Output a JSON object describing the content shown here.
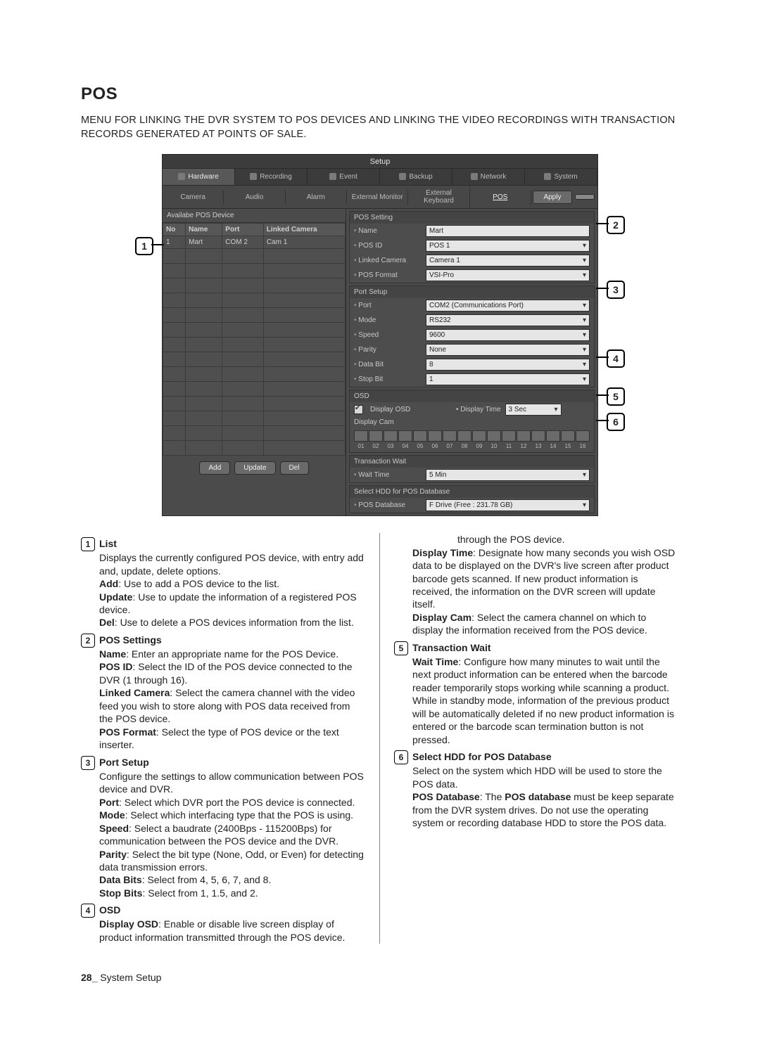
{
  "heading": "POS",
  "intro": "MENU FOR LINKING THE DVR SYSTEM TO POS DEVICES AND LINKING THE VIDEO RECORDINGS WITH TRANSACTION RECORDS GENERATED AT POINTS OF SALE.",
  "footer_page": "28_",
  "footer_text": "System Setup",
  "callouts": [
    "1",
    "2",
    "3",
    "4",
    "5",
    "6"
  ],
  "setup": {
    "window_title": "Setup",
    "tabs": [
      "Hardware",
      "Recording",
      "Event",
      "Backup",
      "Network",
      "System"
    ],
    "subtabs": [
      "Camera",
      "Audio",
      "Alarm",
      "External Monitor",
      "External Keyboard",
      "POS"
    ],
    "apply_btn": "Apply",
    "available_title": "Availabe POS Device",
    "columns": [
      "No",
      "Name",
      "Port",
      "Linked Camera"
    ],
    "row1": {
      "no": "1",
      "name": "Mart",
      "port": "COM 2",
      "cam": "Cam 1"
    },
    "list_btns": {
      "add": "Add",
      "update": "Update",
      "del": "Del"
    },
    "pos_setting": {
      "title": "POS Setting",
      "name_lbl": "Name",
      "name_val": "Mart",
      "posid_lbl": "POS ID",
      "posid_val": "POS 1",
      "linked_lbl": "Linked Camera",
      "linked_val": "Camera 1",
      "fmt_lbl": "POS Format",
      "fmt_val": "VSI-Pro"
    },
    "port_setup": {
      "title": "Port Setup",
      "port_lbl": "Port",
      "port_val": "COM2 (Communications Port)",
      "mode_lbl": "Mode",
      "mode_val": "RS232",
      "speed_lbl": "Speed",
      "speed_val": "9600",
      "parity_lbl": "Parity",
      "parity_val": "None",
      "databit_lbl": "Data Bit",
      "databit_val": "8",
      "stopbit_lbl": "Stop Bit",
      "stopbit_val": "1"
    },
    "osd": {
      "title": "OSD",
      "display_osd": "Display OSD",
      "display_time_lbl": "Display Time",
      "display_time_val": "3 Sec",
      "display_cam": "Display Cam",
      "nums": [
        "01",
        "02",
        "03",
        "04",
        "05",
        "06",
        "07",
        "08",
        "09",
        "10",
        "11",
        "12",
        "13",
        "14",
        "15",
        "16"
      ]
    },
    "trans": {
      "title": "Transaction Wait",
      "wait_lbl": "Wait Time",
      "wait_val": "5 Min"
    },
    "hdd": {
      "title": "Select HDD for POS Database",
      "db_lbl": "POS Database",
      "db_val": "F Drive (Free : 231.78 GB)"
    }
  },
  "desc": {
    "s1": {
      "head": "List",
      "p1": "Displays the currently configured POS device, with entry add and, update, delete options.",
      "add_b": "Add",
      "add": ": Use to add a POS device to the list.",
      "upd_b": "Update",
      "upd": ": Use to update the information of a registered POS device.",
      "del_b": "Del",
      "del": ": Use to delete a POS devices information from the list."
    },
    "s2": {
      "head": "POS Settings",
      "name_b": "Name",
      "name": ": Enter an appropriate name for the POS Device.",
      "posid_b": "POS ID",
      "posid": ": Select the ID of the POS device connected to the DVR (1 through 16).",
      "lc_b": "Linked Camera",
      "lc": ": Select the camera channel with the video feed you wish to store along with POS data received from the POS device.",
      "fmt_b": "POS Format",
      "fmt": ": Select the type of POS device or the text inserter."
    },
    "s3": {
      "head": "Port Setup",
      "p1": "Configure the settings to allow communication between POS device and DVR.",
      "port_b": "Port",
      "port": ": Select which DVR port the POS device is connected.",
      "mode_b": "Mode",
      "mode": ": Select which interfacing type that the POS is using.",
      "speed_b": "Speed",
      "speed": ": Select a baudrate (2400Bps - 115200Bps) for communication between the POS device and the DVR.",
      "parity_b": "Parity",
      "parity": ": Select the bit type (None, Odd, or Even) for detecting data transmission errors.",
      "db_b": "Data Bits",
      "db": ": Select from 4, 5, 6, 7, and 8.",
      "sb_b": "Stop Bits",
      "sb": ": Select from 1, 1.5, and 2."
    },
    "s4": {
      "head": "OSD",
      "dosd_b": "Display OSD",
      "dosd": ": Enable or disable live screen display of product information transmitted through the POS device.",
      "dtime_b": "Display Time",
      "dtime": ": Designate how many seconds you wish OSD data to be displayed on the DVR's live screen after product barcode gets scanned. If new product information is received, the information on the DVR screen will update itself.",
      "dcam_b": "Display Cam",
      "dcam": ": Select the camera channel on which to display the information received from the POS device."
    },
    "s5": {
      "head": "Transaction Wait",
      "wt_b": "Wait Time",
      "wt": ": Configure how many minutes to wait until the next product information can be entered when the barcode reader temporarily stops working while scanning a product. While in standby mode, information of the previous product will be automatically deleted if no new product information is entered or the barcode scan termination button is not pressed."
    },
    "s6": {
      "head": "Select HDD for POS Database",
      "p1": "Select on the system which HDD will be used to store the POS data.",
      "pd_b": "POS Database",
      "pd_a": ": The ",
      "pd_b2": "POS database",
      "pd_c": " must be keep separate from the DVR system drives. Do not use the operating system or recording database HDD to store the POS data."
    }
  }
}
